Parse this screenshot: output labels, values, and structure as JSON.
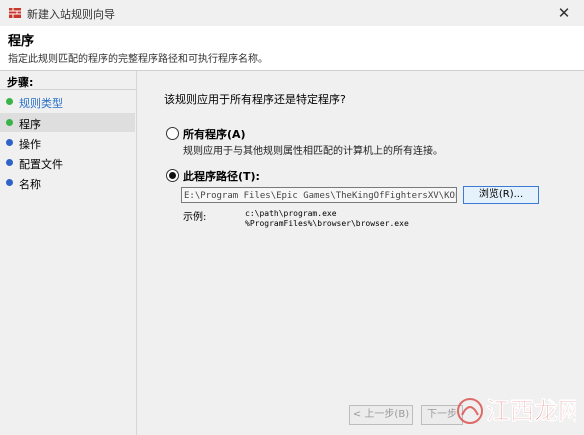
{
  "window": {
    "title": "新建入站规则向导",
    "close_glyph": "✕"
  },
  "header": {
    "title": "程序",
    "subtitle": "指定此规则匹配的程序的完整程序路径和可执行程序名称。"
  },
  "sidebar": {
    "title": "步骤:",
    "items": [
      {
        "label": "规则类型",
        "state": "done"
      },
      {
        "label": "程序",
        "state": "current"
      },
      {
        "label": "操作",
        "state": "pending"
      },
      {
        "label": "配置文件",
        "state": "pending"
      },
      {
        "label": "名称",
        "state": "pending"
      }
    ]
  },
  "main": {
    "question": "该规则应用于所有程序还是特定程序?",
    "option_all": {
      "label": "所有程序(A)",
      "description": "规则应用于与其他规则属性相匹配的计算机上的所有连接。",
      "checked": false
    },
    "option_path": {
      "label": "此程序路径(T):",
      "checked": true,
      "value": "E:\\Program Files\\Epic Games\\TheKingOfFightersXV\\KOFXV\\Bi"
    },
    "browse_label": "浏览(R)...",
    "example_label": "示例:",
    "example_lines": [
      "c:\\path\\program.exe",
      "%ProgramFiles%\\browser\\browser.exe"
    ]
  },
  "footer": {
    "back_label": "< 上一步(B)",
    "next_label": "下一步"
  },
  "watermark": {
    "text": "江西龙网"
  },
  "colors": {
    "accent": "#3a7bd5",
    "done_dot": "#39b34a",
    "pending_dot": "#2f63c7"
  }
}
